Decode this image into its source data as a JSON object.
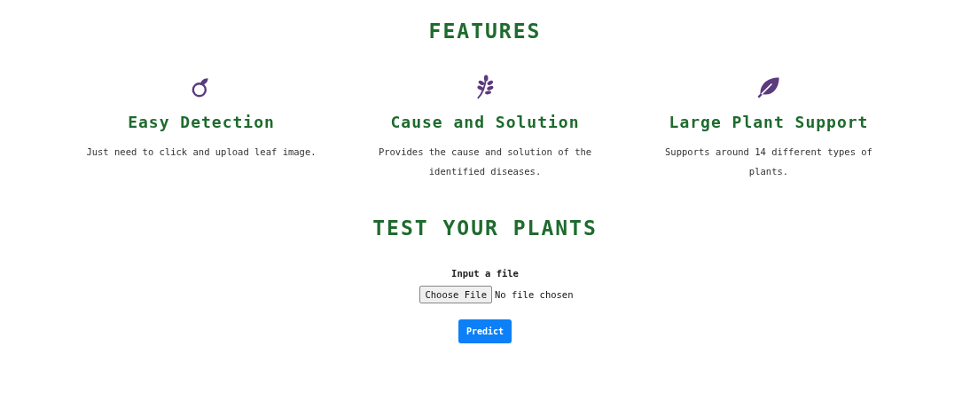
{
  "features_title": "FEATURES",
  "features": [
    {
      "kind": "sprout",
      "title": "Easy Detection",
      "text": "Just need to click and upload leaf image."
    },
    {
      "kind": "herb",
      "title": "Cause and Solution",
      "text": "Provides the cause and solution of the identified diseases."
    },
    {
      "kind": "leaf",
      "title": "Large Plant Support",
      "text": "Supports around 14 different types of plants."
    }
  ],
  "test_title": "TEST YOUR PLANTS",
  "upload": {
    "label": "Input a file",
    "button": "Choose File",
    "status": "No file chosen"
  },
  "submit": "Predict"
}
